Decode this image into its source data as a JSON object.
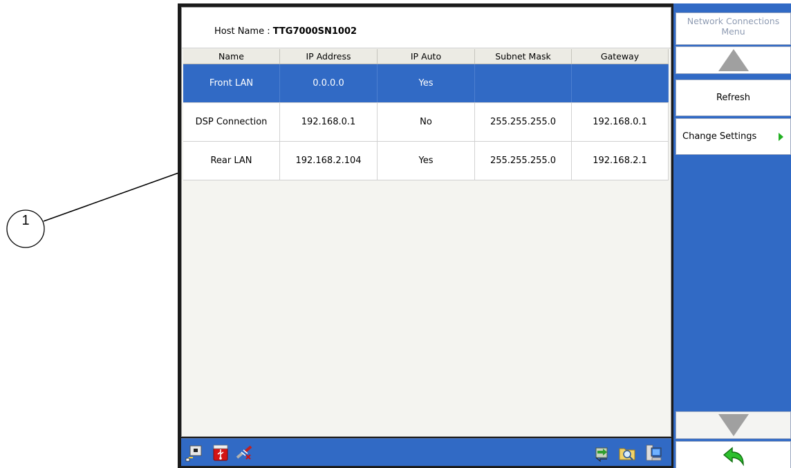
{
  "callout": {
    "number": "1"
  },
  "host": {
    "label": "Host Name : ",
    "value": "TTG7000SN1002"
  },
  "table": {
    "columns": [
      "Name",
      "IP Address",
      "IP Auto",
      "Subnet Mask",
      "Gateway"
    ],
    "rows": [
      {
        "name": "Front LAN",
        "ip": "0.0.0.0",
        "auto": "Yes",
        "subnet": "",
        "gateway": ""
      },
      {
        "name": "DSP Connection",
        "ip": "192.168.0.1",
        "auto": "No",
        "subnet": "255.255.255.0",
        "gateway": "192.168.0.1"
      },
      {
        "name": "Rear LAN",
        "ip": "192.168.2.104",
        "auto": "Yes",
        "subnet": "255.255.255.0",
        "gateway": "192.168.2.1"
      }
    ],
    "selected_row": "Front LAN"
  },
  "menu": {
    "title": "Network Connections Menu",
    "refresh_label": "Refresh",
    "change_settings_label": "Change Settings"
  },
  "icons": {
    "taskbar_left": [
      "network-device-icon",
      "usb-icon",
      "disconnected-plug-icon"
    ],
    "taskbar_right": [
      "transfer-icon",
      "folder-search-icon",
      "computer-icon"
    ],
    "menu": [
      "scroll-up-icon",
      "submenu-arrow-icon",
      "scroll-down-icon",
      "back-arrow-icon"
    ]
  },
  "colors": {
    "selection": "#316ac5",
    "taskbar": "#316ac5",
    "menu_bg": "#316ac5",
    "accent_green": "#22b022"
  }
}
